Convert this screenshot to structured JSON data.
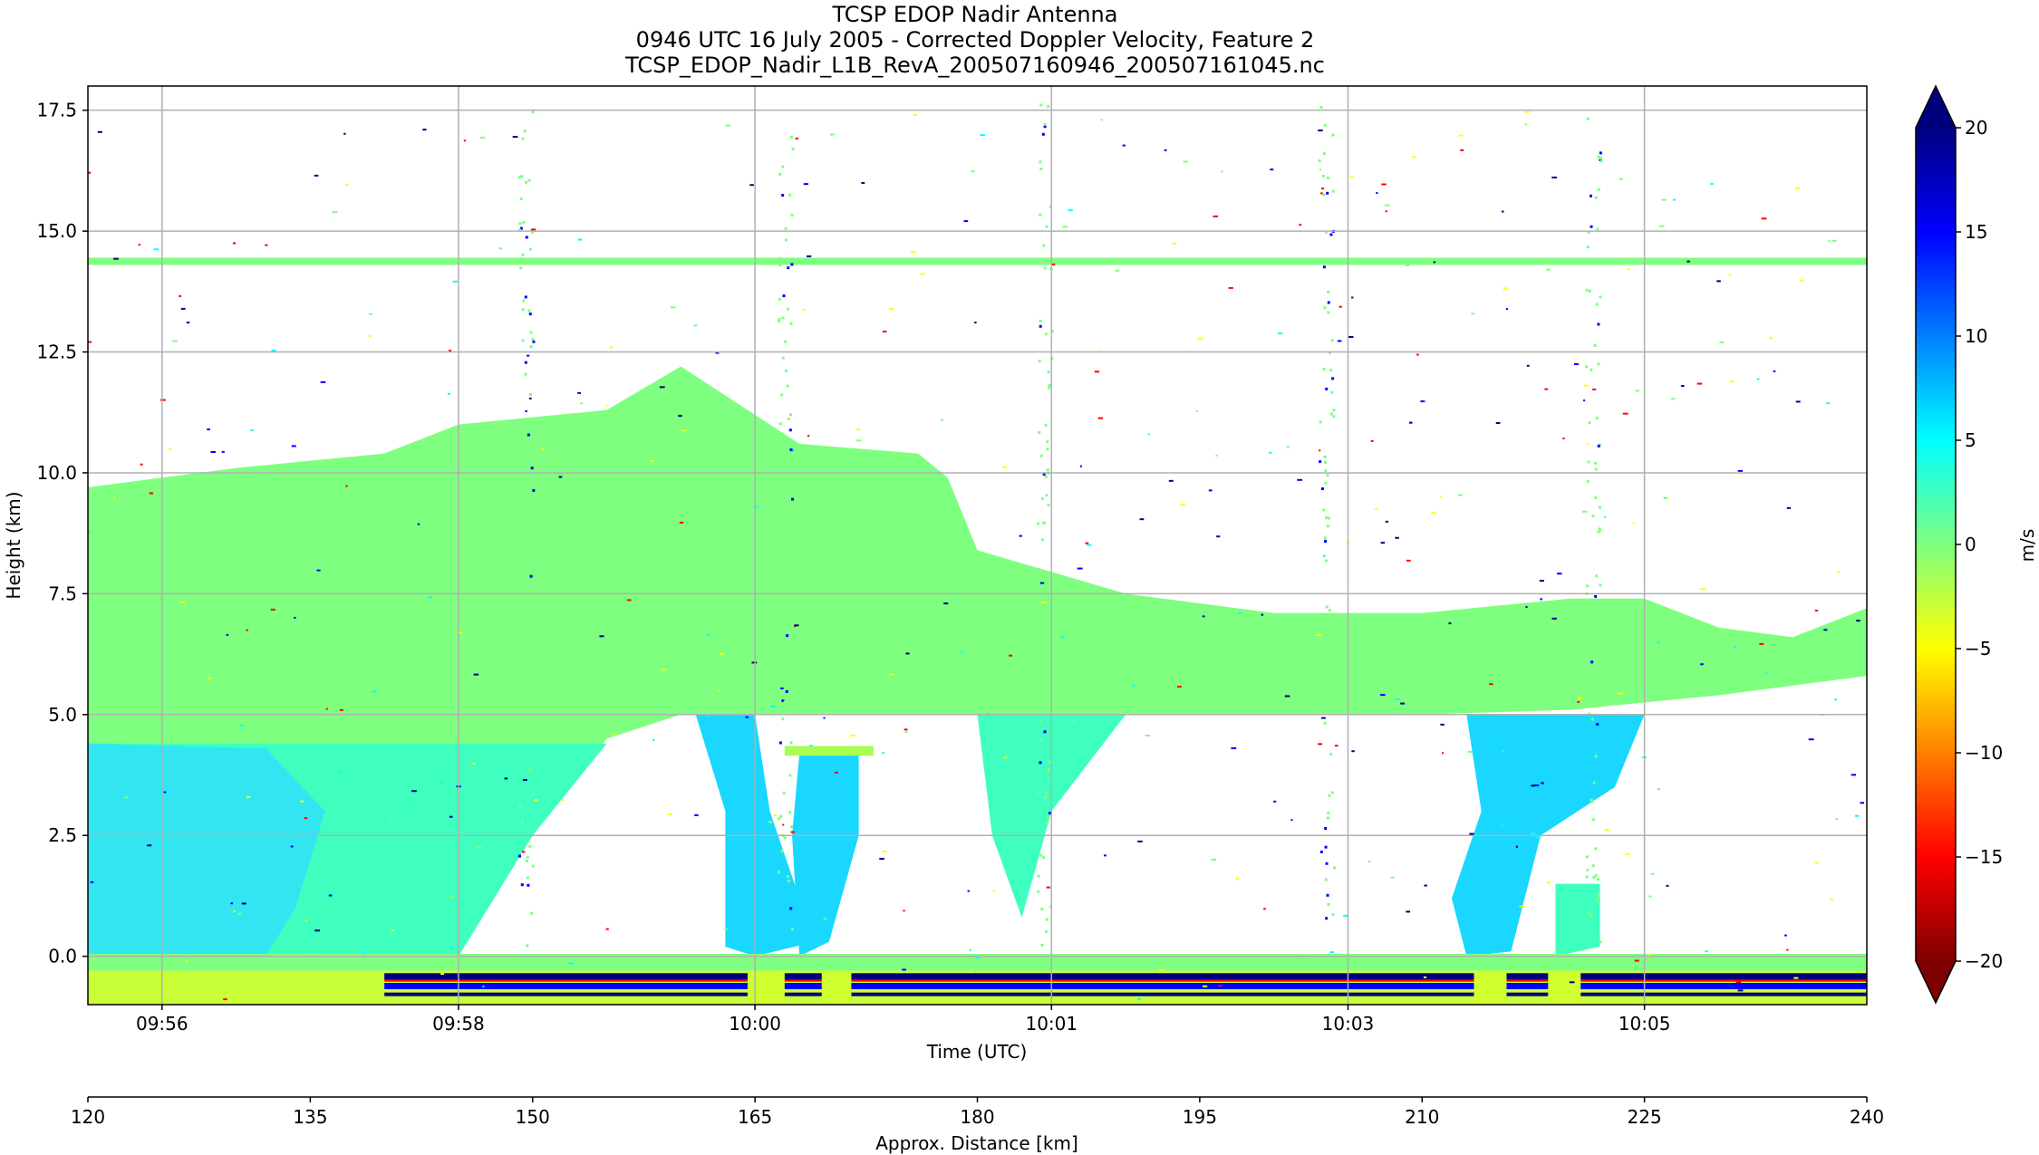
{
  "title_lines": [
    "TCSP EDOP Nadir Antenna",
    "0946 UTC 16 July 2005 - Corrected Doppler Velocity, Feature 2",
    "TCSP_EDOP_Nadir_L1B_RevA_200507160946_200507161045.nc"
  ],
  "chart_data": {
    "type": "heatmap",
    "title": "TCSP EDOP Nadir Antenna",
    "subtitle": "0946 UTC 16 July 2005 - Corrected Doppler Velocity, Feature 2",
    "file": "TCSP_EDOP_Nadir_L1B_RevA_200507160946_200507161045.nc",
    "xlabel": "Time (UTC)",
    "ylabel": "Height (km)",
    "x_ticks": [
      "09:56",
      "09:58",
      "10:00",
      "10:01",
      "10:03",
      "10:05"
    ],
    "x_tick_minutes": [
      0.5,
      2.5,
      4.5,
      6.5,
      8.5,
      10.5
    ],
    "x_range_minutes": [
      0,
      12
    ],
    "y_ticks": [
      "0.0",
      "2.5",
      "5.0",
      "7.5",
      "10.0",
      "12.5",
      "15.0",
      "17.5"
    ],
    "y_tick_values": [
      0,
      2.5,
      5,
      7.5,
      10,
      12.5,
      15,
      17.5
    ],
    "ylim": [
      -1.0,
      18.0
    ],
    "secondary_x": {
      "label": "Approx. Distance [km]",
      "ticks": [
        "120",
        "135",
        "150",
        "165",
        "180",
        "195",
        "210",
        "225",
        "240"
      ],
      "values": [
        120,
        135,
        150,
        165,
        180,
        195,
        210,
        225,
        240
      ],
      "range": [
        120,
        240
      ]
    },
    "colorbar": {
      "label": "m/s",
      "range": [
        -20,
        20
      ],
      "ticks": [
        "20",
        "15",
        "10",
        "5",
        "0",
        "−5",
        "−10",
        "−15",
        "−20"
      ],
      "tick_values": [
        20,
        15,
        10,
        5,
        0,
        -5,
        -10,
        -15,
        -20
      ],
      "colormap": "jet",
      "extend": "both"
    },
    "grid": true,
    "features": {
      "anvil_layer_top_km": 14.4,
      "bright_band_height_km": 4.5,
      "surface_height_km": 0.0
    }
  },
  "colors": {
    "near_zero_velocity": "#7fff7f",
    "positive_velocity": "#19d7ff",
    "max_positive": "#00007f",
    "max_negative": "#7f0000",
    "grid": "#b0b0b0"
  }
}
